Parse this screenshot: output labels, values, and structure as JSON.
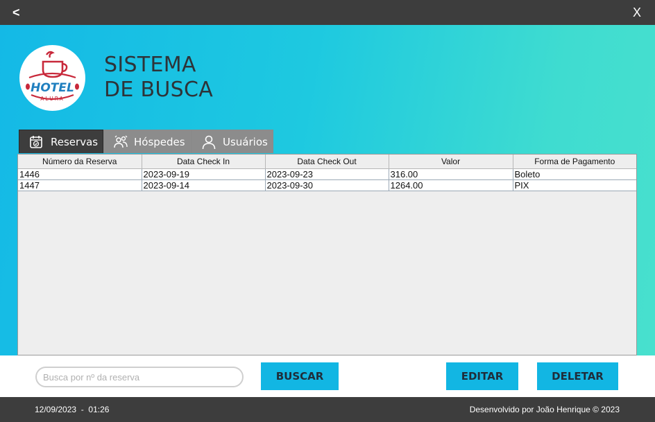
{
  "titlebar": {
    "back_label": "<",
    "close_label": "X"
  },
  "logo": {
    "text_main": "HOTEL",
    "text_sub": "ALURA"
  },
  "header": {
    "title_line1": "SISTEMA",
    "title_line2": "DE BUSCA"
  },
  "tabs": [
    {
      "label": "Reservas",
      "icon": "calendar-check-icon",
      "active": true
    },
    {
      "label": "Hóspedes",
      "icon": "guests-icon",
      "active": false
    },
    {
      "label": "Usuários",
      "icon": "user-icon",
      "active": false
    }
  ],
  "table": {
    "columns": [
      "Número da Reserva",
      "Data Check In",
      "Data Check Out",
      "Valor",
      "Forma de Pagamento"
    ],
    "rows": [
      [
        "1446",
        "2023-09-19",
        "2023-09-23",
        "316.00",
        "Boleto"
      ],
      [
        "1447",
        "2023-09-14",
        "2023-09-30",
        "1264.00",
        "PIX"
      ]
    ]
  },
  "search": {
    "placeholder": "Busca por nº da reserva",
    "value": ""
  },
  "buttons": {
    "search_label": "BUSCAR",
    "edit_label": "EDITAR",
    "delete_label": "DELETAR"
  },
  "footer": {
    "datetime": "12/09/2023  -  01:26",
    "credit": "Desenvolvido por João Henrique © 2023"
  },
  "colors": {
    "accent": "#12b6e3",
    "dark": "#3d3d3d",
    "gradient_start": "#14b9e6",
    "gradient_end": "#48e0ce"
  }
}
